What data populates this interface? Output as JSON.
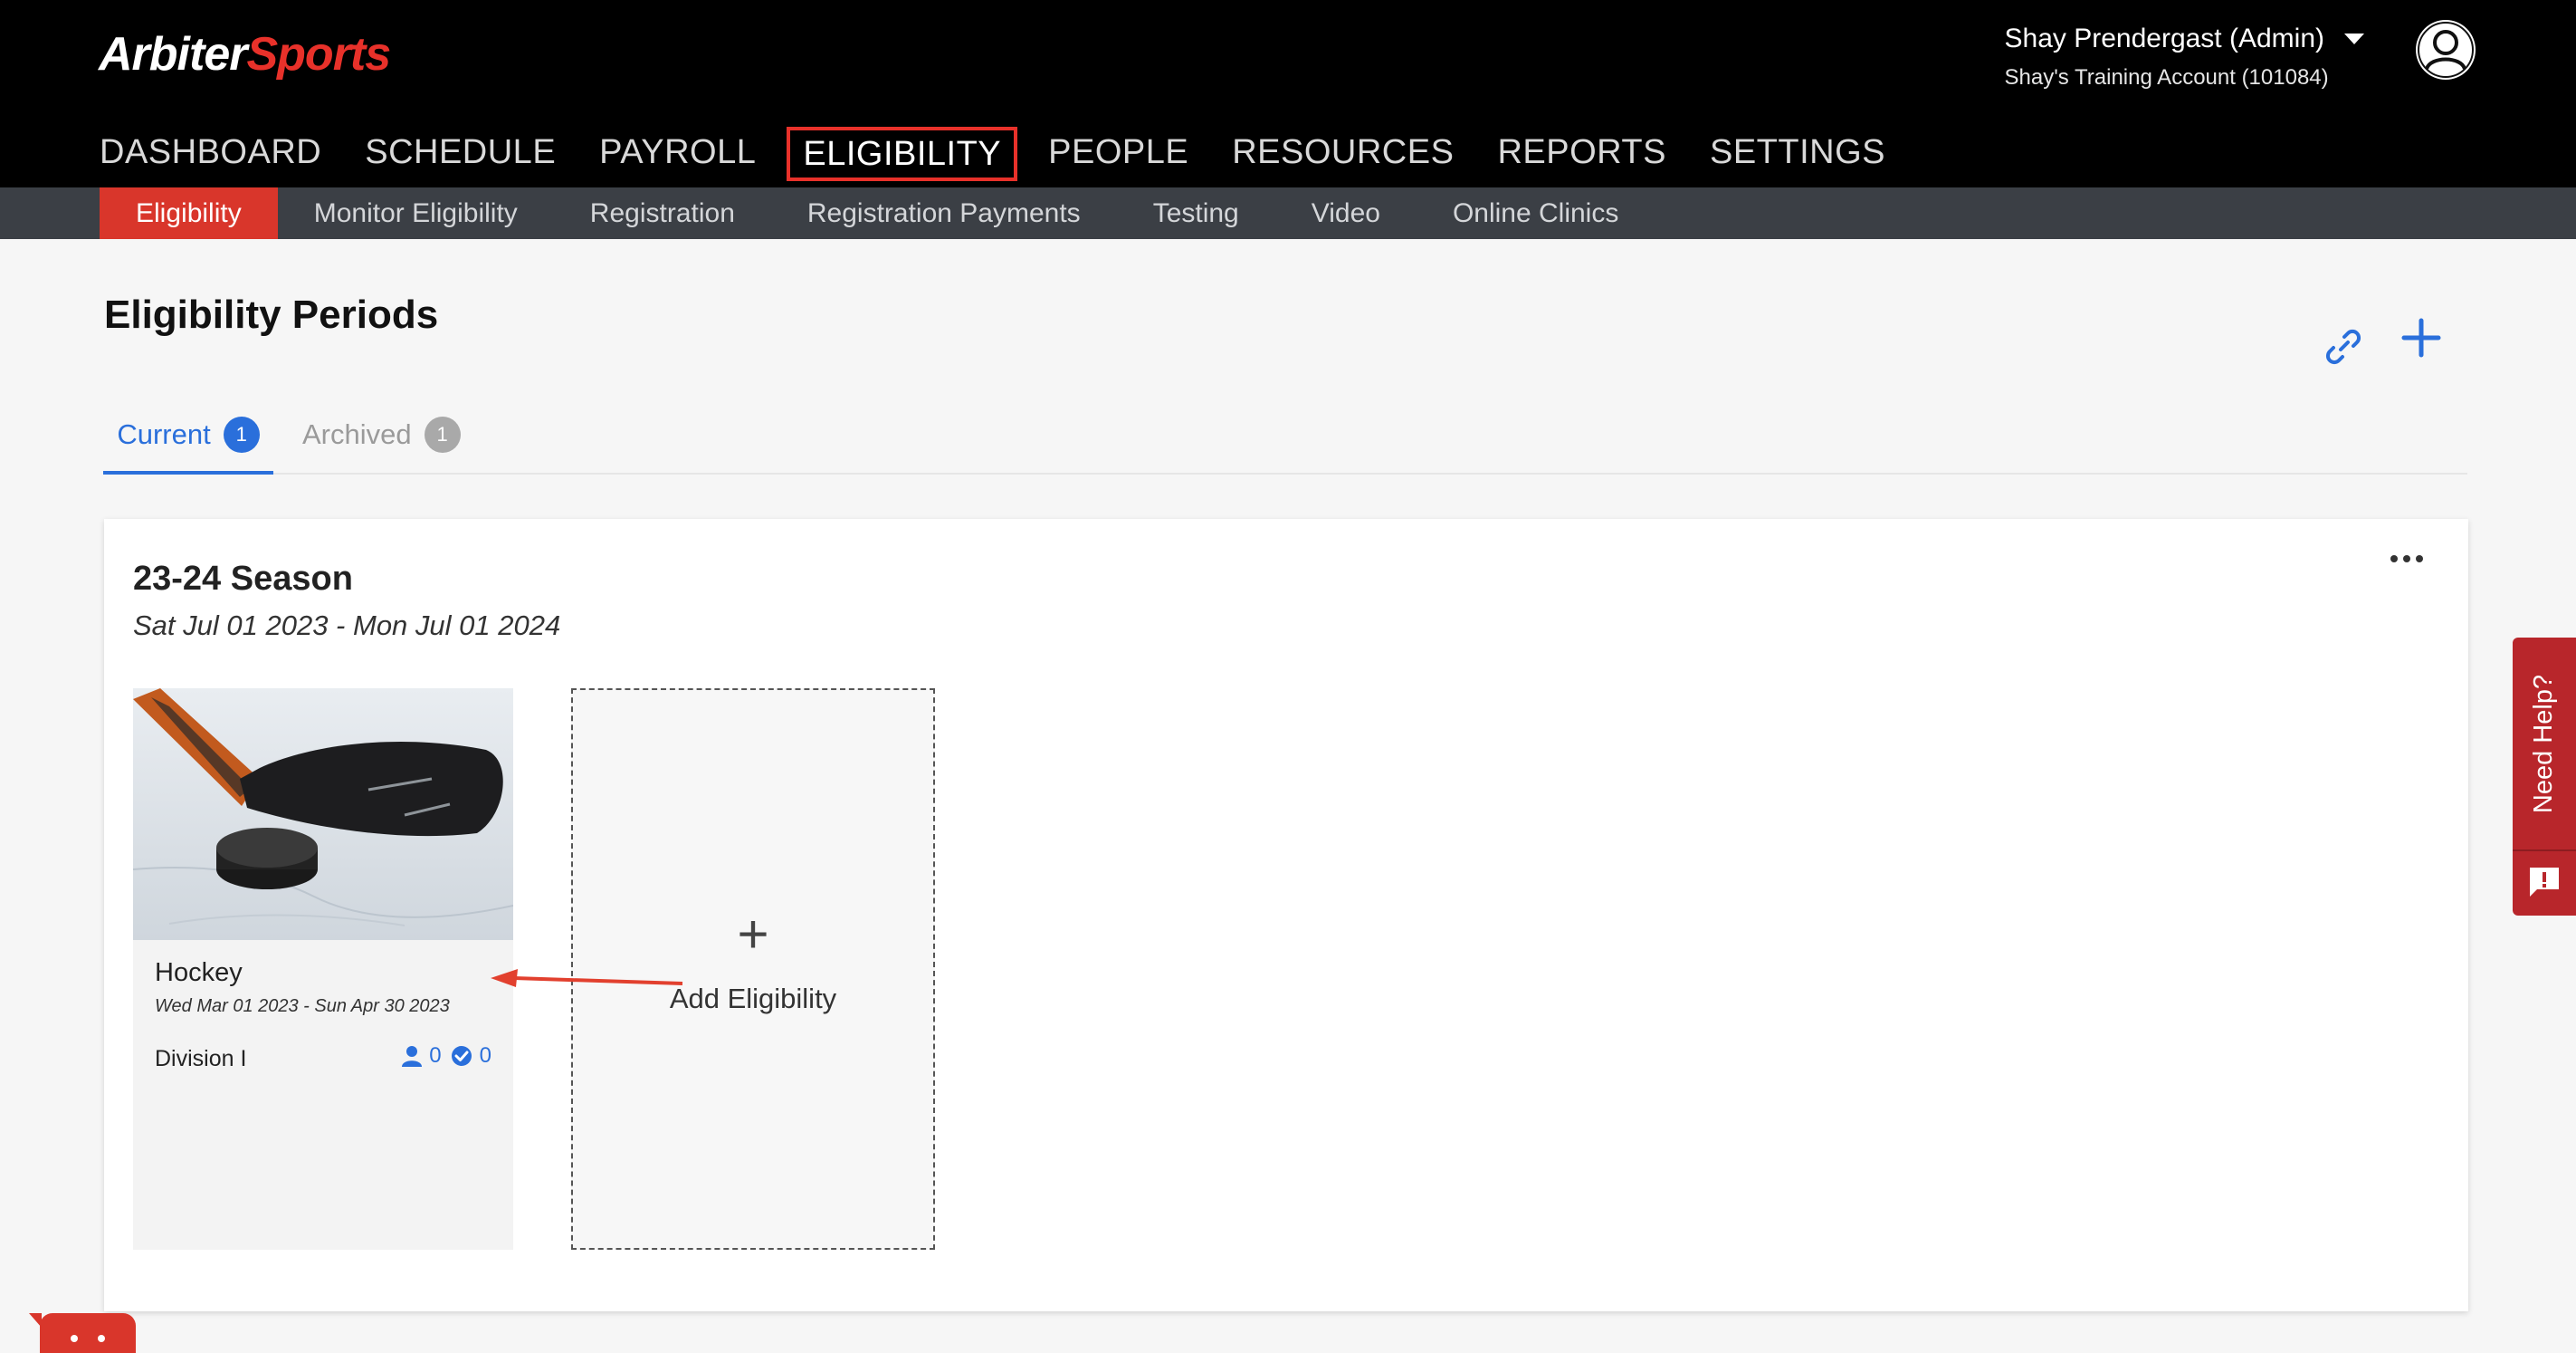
{
  "brand": {
    "logo_part1": "Arbiter",
    "logo_part2": "Sports"
  },
  "user": {
    "name": "Shay Prendergast (Admin)",
    "account": "Shay's Training Account (101084)"
  },
  "main_nav": [
    "DASHBOARD",
    "SCHEDULE",
    "PAYROLL",
    "ELIGIBILITY",
    "PEOPLE",
    "RESOURCES",
    "REPORTS",
    "SETTINGS"
  ],
  "main_nav_active": "ELIGIBILITY",
  "sub_nav": [
    "Eligibility",
    "Monitor Eligibility",
    "Registration",
    "Registration Payments",
    "Testing",
    "Video",
    "Online Clinics"
  ],
  "sub_nav_active": "Eligibility",
  "page": {
    "title": "Eligibility Periods",
    "tabs": [
      {
        "label": "Current",
        "count": "1"
      },
      {
        "label": "Archived",
        "count": "1"
      }
    ]
  },
  "season": {
    "title": "23-24 Season",
    "dates": "Sat Jul 01 2023 - Mon Jul 01 2024",
    "eligibility": {
      "name": "Hockey",
      "dates": "Wed Mar 01 2023 - Sun Apr 30 2023",
      "division": "Division I",
      "people_count": "0",
      "verified_count": "0"
    },
    "add_label": "Add Eligibility",
    "add_symbol": "+"
  },
  "help": {
    "label": "Need Help?"
  },
  "colors": {
    "accent_red": "#e8312a",
    "link_blue": "#2a6fdb",
    "header_bg": "#000000",
    "subnav_bg": "#3b3f45"
  }
}
